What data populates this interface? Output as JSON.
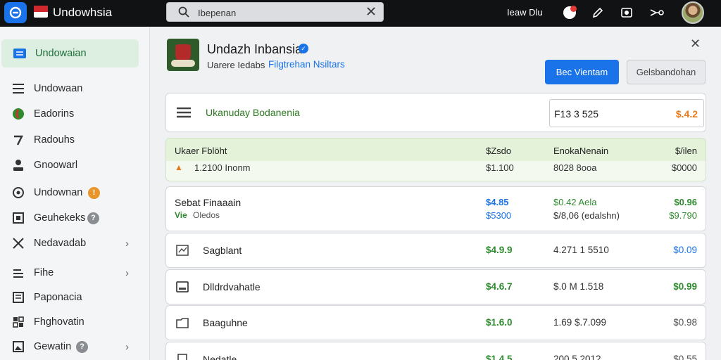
{
  "topbar": {
    "app_title": "Undowhsia",
    "search_value": "Ibepenan",
    "user_name": "Ieaw Dlu"
  },
  "sidebar": {
    "items": [
      {
        "label": "Undowaian",
        "active": true
      },
      {
        "label": "Undowaan"
      },
      {
        "label": "Eadorins"
      },
      {
        "label": "Radouhs"
      },
      {
        "label": "Gnoowarl"
      },
      {
        "label": "Undownan"
      },
      {
        "label": "Geuhekeks"
      },
      {
        "label": "Nedavadab"
      },
      {
        "label": "Fihe"
      },
      {
        "label": "Paponacia"
      },
      {
        "label": "Fhghovatin"
      },
      {
        "label": "Gewatin"
      }
    ]
  },
  "header": {
    "title": "Undazh Inbansia",
    "subtitle": "Uarere Iedabs",
    "subtitle_link": "Filgtrehan Nsiltars",
    "primary_button": "Bec Vientam",
    "secondary_button": "Gelsbandohan"
  },
  "summary": {
    "label": "Ukanuday Bodanenia",
    "field_value": "F13 3 525",
    "field_amount": "$.4.2"
  },
  "table": {
    "headers": [
      "Ukaer Fblöht",
      "$Zsdo",
      "EnokaNenain",
      "$/ilen"
    ],
    "summary_row": {
      "label": "1.2100 Inonm",
      "c1": "$1.100",
      "c2": "8028 8ooa",
      "c3": "$0000"
    }
  },
  "multi_row": {
    "name": "Sebat Finaaain",
    "sub_a": "Vie",
    "sub_b": "Oledos",
    "price_a": "$4.85",
    "price_b": "$5300",
    "vol_a": "$0.42 Aela",
    "vol_b": "$/8,06 (edalshn)",
    "chg_a": "$0.96",
    "chg_b": "$9.790"
  },
  "rows": [
    {
      "name": "Sagblant",
      "price": "$4.9.9",
      "volume": "4.271 1 5510",
      "change": "$0.09"
    },
    {
      "name": "Dlldrdvahatle",
      "price": "$4.6.7",
      "volume": "$.0 M 1.518",
      "change": "$0.99"
    },
    {
      "name": "Baaguhne",
      "price": "$1.6.0",
      "volume": "1.69 $.7.099",
      "change": "$0.98"
    },
    {
      "name": "Nedatle",
      "price": "$1.4.5",
      "volume": "200 5 2012",
      "change": "$0.55"
    }
  ],
  "colors": {
    "accent": "#1a73e8",
    "positive": "#2e8b2e",
    "header_green": "#e4f2da",
    "warning": "#e87a1c",
    "topbar": "#101214"
  }
}
